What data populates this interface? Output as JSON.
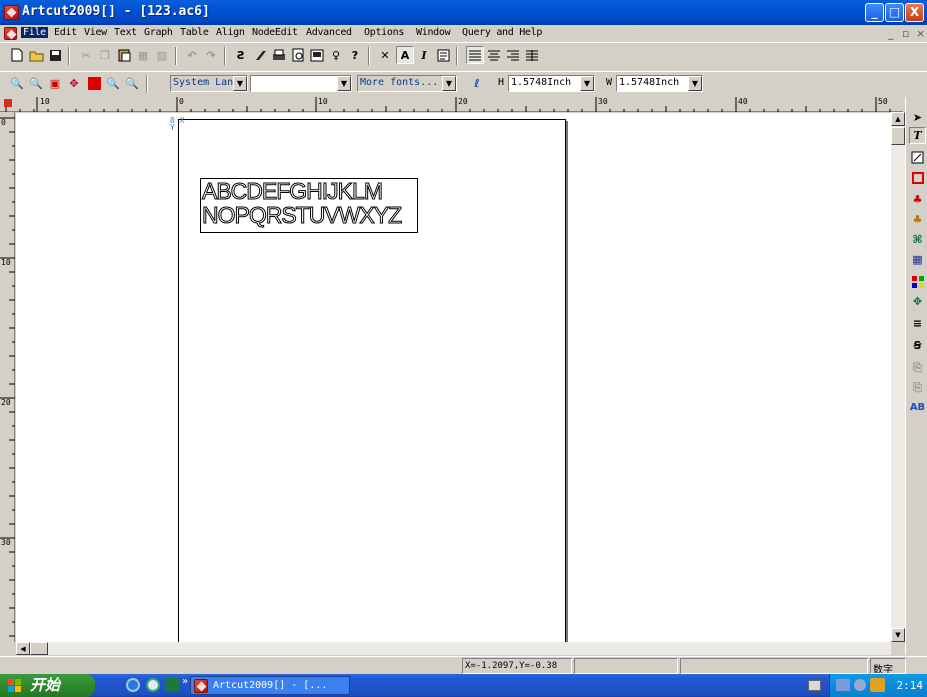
{
  "window": {
    "title": "Artcut2009[] - [123.ac6]",
    "controls": {
      "minimize": "_",
      "maximize": "□",
      "close": "X"
    }
  },
  "menubar": {
    "items": [
      "File",
      "Edit",
      "View",
      "Text",
      "Graph",
      "Table",
      "Align",
      "NodeEdit",
      "Advanced",
      "Options",
      "Window",
      "Query and Help"
    ],
    "active": "File",
    "mdi_controls": [
      "_",
      "▫",
      "×"
    ]
  },
  "toolbar1": {
    "buttons": [
      "new-icon",
      "open-icon",
      "save-icon",
      "cut-icon",
      "copy-icon",
      "paste-icon",
      "print-preview-icon",
      "scan-icon",
      "undo-icon",
      "redo-icon",
      "mirror-icon",
      "rotate-icon",
      "printer-icon",
      "preview-icon",
      "cut-plot-icon",
      "bulb-icon",
      "help-icon",
      "ruler-icon",
      "bold-icon",
      "italic-icon",
      "edit-text-icon",
      "align-left-icon",
      "align-center-icon",
      "align-right-icon",
      "justify-icon"
    ]
  },
  "toolbar2": {
    "font_name": "System Lan",
    "font_size": "",
    "more_fonts": "More fonts...",
    "height_label": "H",
    "height_value": "1.5748Inch",
    "width_label": "W",
    "width_value": "1.5748Inch"
  },
  "ruler": {
    "h_labels": [
      "10",
      "0",
      "10",
      "20",
      "30",
      "40",
      "50"
    ],
    "v_labels": [
      "0",
      "10",
      "20",
      "30"
    ]
  },
  "canvas": {
    "origin_label": "0 X\nY",
    "sample_text": "ABCDEFGHIJKLM\nNOPQRSTUVWXYZ"
  },
  "statusbar": {
    "coords": "X=-1.2097,Y=-0.38",
    "mode": "数字"
  },
  "taskbar": {
    "start_label": "开始",
    "task_label": "Artcut2009[] - [...",
    "clock": "2:14",
    "chevron": "»"
  },
  "colors": {
    "titlebar": "#0052d6",
    "taskbar": "#2157d3",
    "start": "#2e8b2e",
    "menu_highlight": "#0a246a"
  }
}
